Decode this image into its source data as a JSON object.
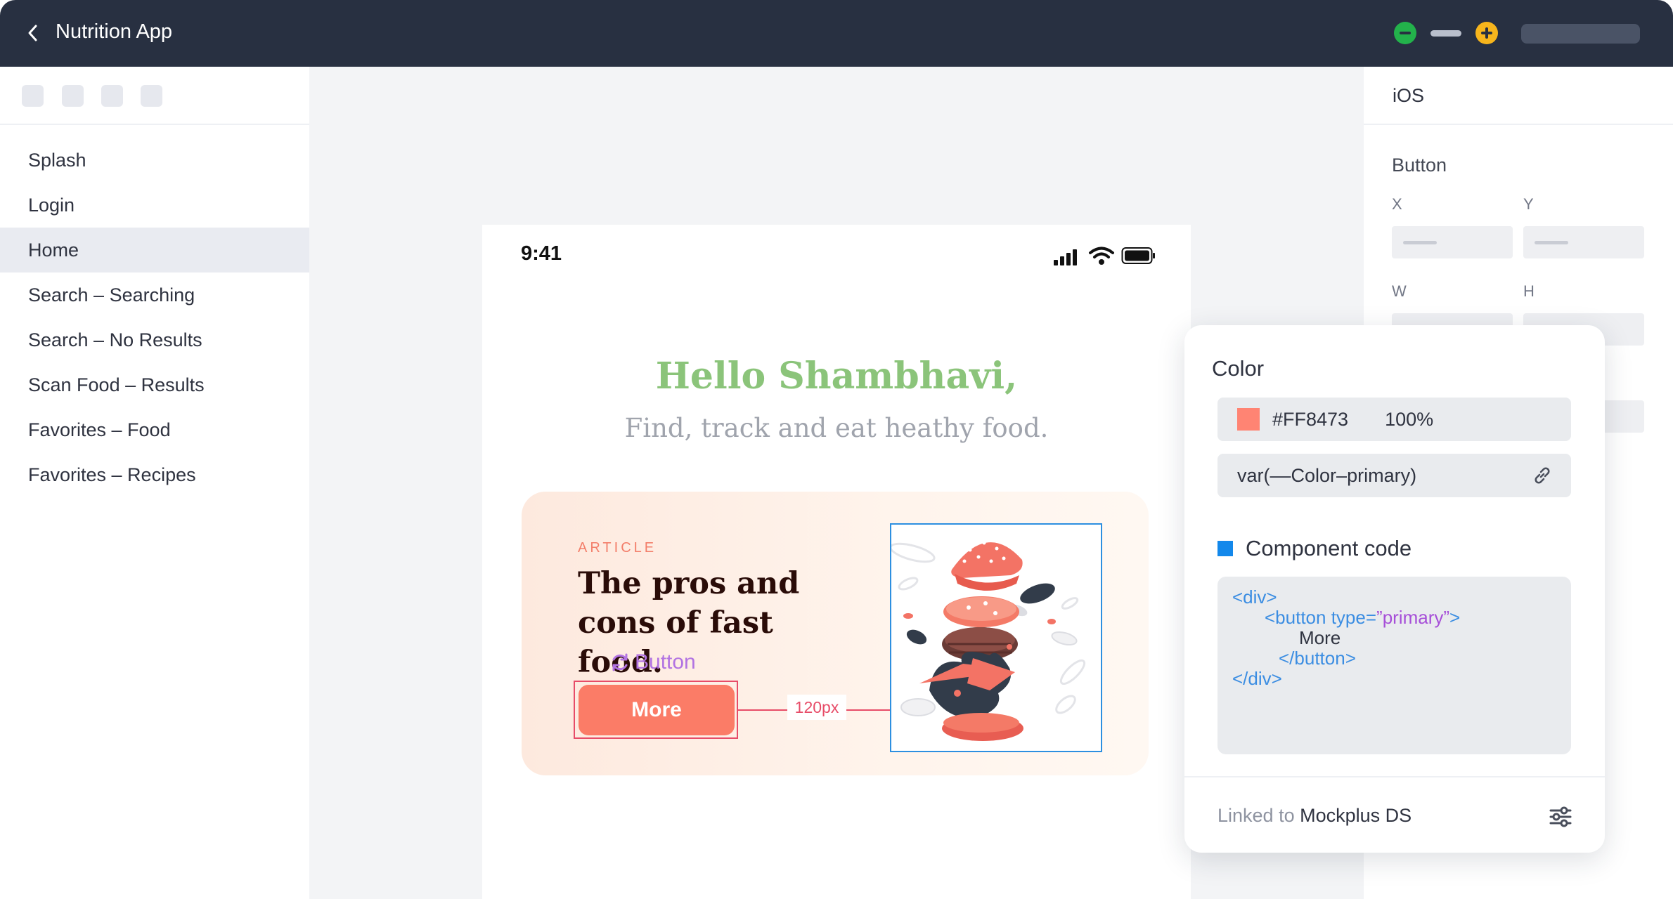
{
  "header": {
    "title": "Nutrition App",
    "icons": [
      "back-icon",
      "minimize-icon",
      "window-dash-icon",
      "add-icon"
    ]
  },
  "sidebar": {
    "items": [
      {
        "label": "Splash",
        "active": false
      },
      {
        "label": "Login",
        "active": false
      },
      {
        "label": "Home",
        "active": true
      },
      {
        "label": "Search – Searching",
        "active": false
      },
      {
        "label": "Search – No Results",
        "active": false
      },
      {
        "label": "Scan Food – Results",
        "active": false
      },
      {
        "label": "Favorites – Food",
        "active": false
      },
      {
        "label": "Favorites – Recipes",
        "active": false
      }
    ]
  },
  "phone": {
    "time": "9:41",
    "greeting": "Hello Shambhavi,",
    "tagline": "Find, track and eat heathy food.",
    "card": {
      "kicker": "ARTICLE",
      "title": "The pros and cons of fast food.",
      "component_label": "Button",
      "button_label": "More",
      "measure": "120px"
    }
  },
  "inspector": {
    "platform": "iOS",
    "section": "Button",
    "x_label": "X",
    "y_label": "Y",
    "w_label": "W",
    "h_label": "H"
  },
  "popover": {
    "color_title": "Color",
    "hex": "#FF8473",
    "opacity": "100%",
    "variable": "var(––Color–primary)",
    "code_title": "Component code",
    "code": {
      "line1": "<div>",
      "line2_open": "<button type=",
      "line2_value": "”primary”",
      "line2_close": ">",
      "line3": "More",
      "line4": "</button>",
      "line5": "</div>"
    },
    "linked_prefix": "Linked to ",
    "linked_ds": "Mockplus DS"
  },
  "colors": {
    "primary": "#FF8473",
    "greeting": "#8bc47a",
    "header_bg": "#283041",
    "selection": "#e74c68",
    "image_frame": "#2d8fe0"
  }
}
